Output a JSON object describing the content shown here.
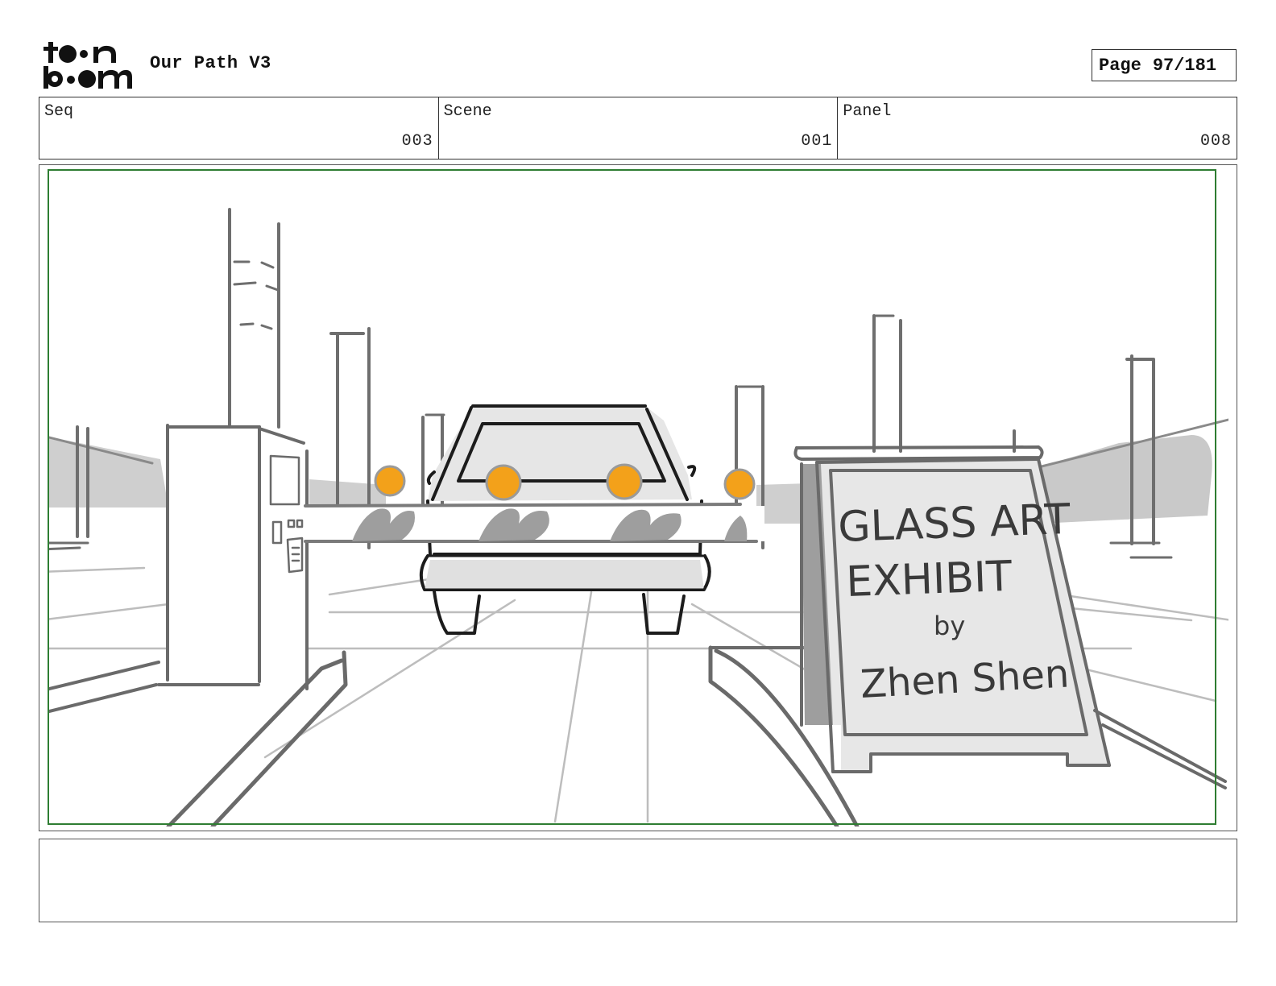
{
  "header": {
    "logo_text": "toon boom",
    "project_title": "Our Path V3",
    "page_label": "Page",
    "page_number": "97/181"
  },
  "info": {
    "seq_label": "Seq",
    "seq_value": "003",
    "scene_label": "Scene",
    "scene_value": "001",
    "panel_label": "Panel",
    "panel_value": "008"
  },
  "panel": {
    "sign_line_1": "GLASS ART",
    "sign_line_2": "EXHIBIT",
    "sign_line_3": "by",
    "sign_line_4": "Zhen Shen",
    "frame_color": "#2e7d32",
    "light_color": "#f3a11a"
  },
  "notes": {
    "text": ""
  }
}
